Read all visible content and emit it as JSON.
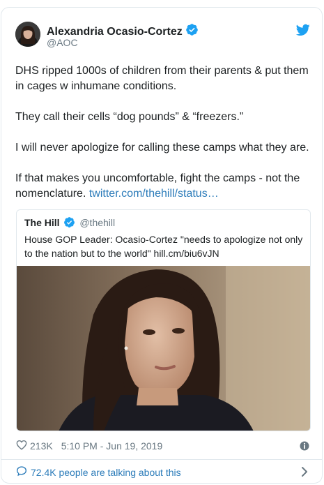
{
  "author": {
    "name": "Alexandria Ocasio-Cortez",
    "handle": "@AOC"
  },
  "tweet": {
    "paragraphs": [
      "DHS ripped 1000s of children from their parents & put them in cages w inhumane conditions.",
      "They call their cells “dog pounds” & “freezers.”",
      "I will never apologize for calling these camps what they are."
    ],
    "last_paragraph_text": "If that makes you uncomfortable, fight the camps - not the nomenclature.",
    "link_text": "twitter.com/thehill/status…"
  },
  "quoted": {
    "name": "The Hill",
    "handle": "@thehill",
    "text": "House GOP Leader: Ocasio-Cortez \"needs to apologize not only to the nation but to the world\" hill.cm/biu6vJN"
  },
  "footer": {
    "likes": "213K",
    "timestamp": "5:10 PM - Jun 19, 2019",
    "talking": "72.4K people are talking about this"
  },
  "colors": {
    "accent": "#1da1f2",
    "link": "#2b7bb9",
    "secondary_text": "#697882",
    "border": "#e1e8ed"
  },
  "icons": {
    "verified": "verified-badge-icon",
    "bird": "twitter-bird-icon",
    "heart": "heart-icon",
    "info": "info-icon",
    "bubble": "speech-bubble-icon",
    "chevron": "chevron-right-icon"
  }
}
